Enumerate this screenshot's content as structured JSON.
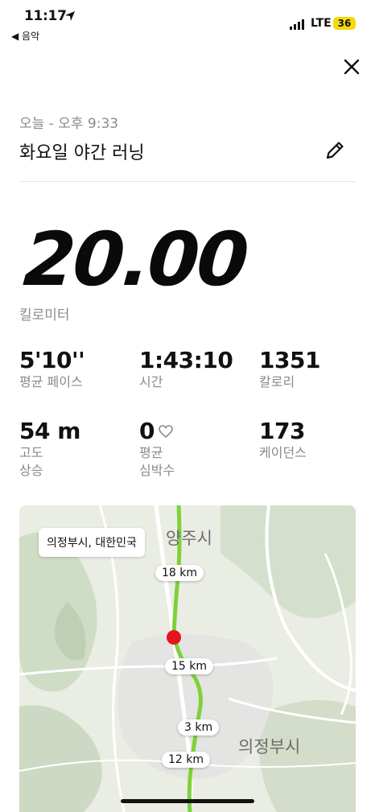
{
  "status_bar": {
    "time": "11:17",
    "back_app": "◀ 음악",
    "network": "LTE",
    "battery": "36"
  },
  "header": {
    "date": "오늘 - 오후 9:33",
    "title": "화요일 야간 러닝"
  },
  "summary": {
    "distance": "20.00",
    "distance_unit": "킬로미터"
  },
  "stats": [
    {
      "value": "5'10''",
      "label": "평균 페이스"
    },
    {
      "value": "1:43:10",
      "label": "시간"
    },
    {
      "value": "1351",
      "label": "칼로리"
    },
    {
      "value": "54 m",
      "label": "고도\n상승"
    },
    {
      "value": "0",
      "label": "평균\n심박수"
    },
    {
      "value": "173",
      "label": "케이던스"
    }
  ],
  "map": {
    "location": "의정부시, 대한민국",
    "km_markers": [
      "18 km",
      "15 km",
      "3 km",
      "12 km"
    ],
    "place_labels": [
      "양주시",
      "의정부시"
    ],
    "route_color": "#7ed13a",
    "start_marker_color": "#e5161b"
  },
  "icons": {
    "close": "close-icon",
    "edit": "pencil-icon",
    "heart": "heart-icon",
    "location": "location-arrow-icon"
  }
}
